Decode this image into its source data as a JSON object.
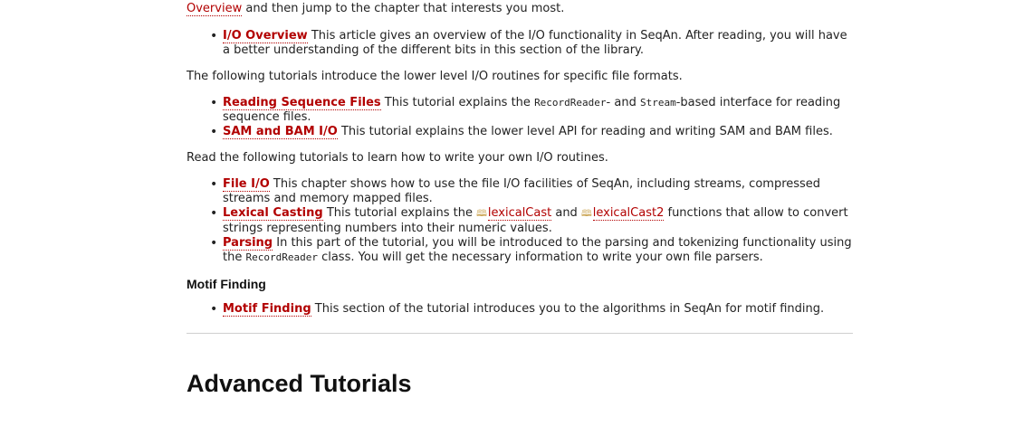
{
  "intro": {
    "link": "Overview",
    "text": " and then jump to the chapter that interests you most."
  },
  "io_overview": {
    "title": "I/O Overview",
    "desc": " This article gives an overview of the I/O functionality in SeqAn. After reading, you will have a better understanding of the different bits in this section of the library."
  },
  "lower_level_intro": "The following tutorials introduce the lower level I/O routines for specific file formats.",
  "reading_seq": {
    "title": "Reading Sequence Files",
    "desc_a": " This tutorial explains the ",
    "code_a": "RecordReader",
    "desc_b": "- and ",
    "code_b": "Stream",
    "desc_c": "-based interface for reading sequence files."
  },
  "sam_bam": {
    "title": "SAM and BAM I/O",
    "desc": " This tutorial explains the lower level API for reading and writing SAM and BAM files."
  },
  "own_io_intro": "Read the following tutorials to learn how to write your own I/O routines.",
  "file_io": {
    "title": "File I/O",
    "desc": " This chapter shows how to use the file I/O facilities of SeqAn, including streams, compressed streams and memory mapped files."
  },
  "lexical": {
    "title": "Lexical Casting",
    "desc_a": " This tutorial explains the ",
    "api_a": "lexicalCast",
    "desc_b": " and ",
    "api_b": "lexicalCast2",
    "desc_c": " functions that allow to convert strings representing numbers into their numeric values."
  },
  "parsing": {
    "title": "Parsing",
    "desc_a": " In this part of the tutorial, you will be introduced to the parsing and tokenizing functionality using the ",
    "code": "RecordReader",
    "desc_b": " class. You will get the necessary information to write your own file parsers."
  },
  "motif_heading": "Motif Finding",
  "motif": {
    "title": "Motif Finding",
    "desc": " This section of the tutorial introduces you to the algorithms in SeqAn for motif finding."
  },
  "advanced_heading": "Advanced Tutorials",
  "api_icon": "book-icon"
}
